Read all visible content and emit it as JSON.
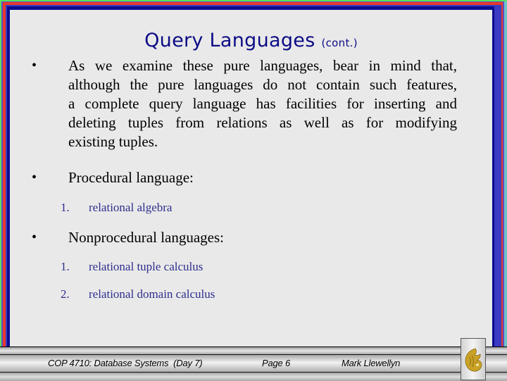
{
  "slide": {
    "title": "Query Languages",
    "title_suffix": "(cont.)",
    "bullet_glyph": "•",
    "bullets": [
      {
        "lines": [
          "As we examine these pure languages, bear in mind that,",
          "although the pure languages do not contain such features,",
          "a complete query language has facilities for inserting and",
          "deleting tuples from relations as well as for modifying",
          "existing tuples."
        ]
      },
      {
        "text": "Procedural language:",
        "subitems": [
          {
            "num": "1.",
            "text": "relational algebra"
          }
        ]
      },
      {
        "text": "Nonprocedural languages:",
        "subitems": [
          {
            "num": "1.",
            "text": "relational tuple calculus"
          },
          {
            "num": "2.",
            "text": "relational domain calculus"
          }
        ]
      }
    ]
  },
  "footer": {
    "course": "COP 4710: Database Systems  (Day 7)",
    "page": "Page 6",
    "author": "Mark Llewellyn",
    "logo_icon": "pegasus-logo-icon"
  },
  "colors": {
    "title": "#0c0c86",
    "subitem": "#2e2e8e",
    "frame_green": "#5ee05a",
    "frame_red": "#e8392b",
    "frame_navy": "#0b0b8e",
    "logo_gold": "#c9a227"
  }
}
